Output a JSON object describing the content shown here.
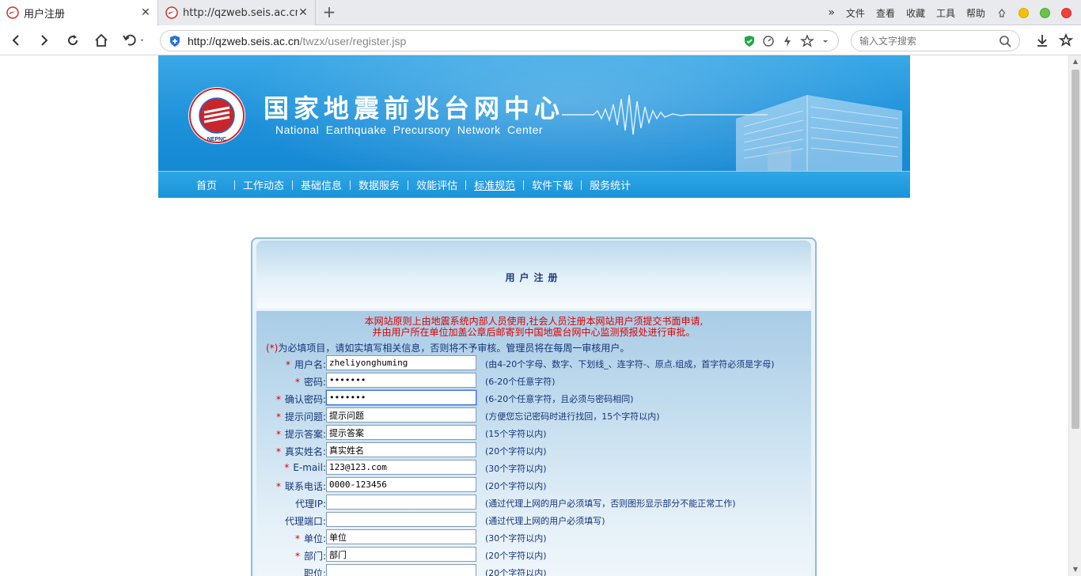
{
  "browser": {
    "tabs": [
      {
        "title": "用户注册",
        "active": true
      },
      {
        "title": "http://qzweb.seis.ac.cn/t",
        "active": false
      }
    ],
    "menu": [
      "文件",
      "查看",
      "收藏",
      "工具",
      "帮助"
    ],
    "url_host": "http://qzweb.seis.ac.cn",
    "url_path": "/twzx/user/register.jsp",
    "search_placeholder": "输入文字搜索"
  },
  "site": {
    "title_cn": "国家地震前兆台网中心",
    "title_en": "National Earthquake Precursory Network Center",
    "logo_text": "NEPNC",
    "nav": [
      "首页",
      "工作动态",
      "基础信息",
      "数据服务",
      "效能评估",
      "标准规范",
      "软件下载",
      "服务统计"
    ]
  },
  "form": {
    "title": "用户注册",
    "notice_line1": "本网站原则上由地震系统内部人员使用,社会人员注册本网站用户须提交书面申请,",
    "notice_line2": "并由用户所在单位加盖公章后邮寄到中国地震台网中心监测预报处进行审批。",
    "required_note_star": "(*)",
    "required_note": "为必填项目，请如实填写相关信息，否则将不予审核。管理员将在每周一审核用户。",
    "fields": [
      {
        "label": "用户名:",
        "required": true,
        "value": "zheliyonghuming",
        "hint": "(由4-20个字母、数字、下划线_、连字符-、原点.组成，首字符必须是字母)"
      },
      {
        "label": "密码:",
        "required": true,
        "value": "•••••••",
        "hint": "(6-20个任意字符)"
      },
      {
        "label": "确认密码:",
        "required": true,
        "value": "•••••••",
        "hint": "(6-20个任意字符，且必须与密码相同)"
      },
      {
        "label": "提示问题:",
        "required": true,
        "value": "提示问题",
        "hint": "(方便您忘记密码时进行找回，15个字符以内)"
      },
      {
        "label": "提示答案:",
        "required": true,
        "value": "提示答案",
        "hint": "(15个字符以内)"
      },
      {
        "label": "真实姓名:",
        "required": true,
        "value": "真实姓名",
        "hint": "(20个字符以内)"
      },
      {
        "label": "E-mail:",
        "required": true,
        "value": "123@123.com",
        "hint": "(30个字符以内)"
      },
      {
        "label": "联系电话:",
        "required": true,
        "value": "0000-123456",
        "hint": "(20个字符以内)"
      },
      {
        "label": "代理IP:",
        "required": false,
        "value": "",
        "hint": "(通过代理上网的用户必须填写，否则图形显示部分不能正常工作)"
      },
      {
        "label": "代理端口:",
        "required": false,
        "value": "",
        "hint": "(通过代理上网的用户必须填写)"
      },
      {
        "label": "单位:",
        "required": true,
        "value": "单位",
        "hint": "(30个字符以内)"
      },
      {
        "label": "部门:",
        "required": true,
        "value": "部门",
        "hint": "(20个字符以内)"
      },
      {
        "label": "职位:",
        "required": false,
        "value": "",
        "hint": "(20个字符以内)"
      }
    ]
  },
  "colors": {
    "banner": "#1d90da",
    "required_star": "#e00000",
    "label_text": "#15357a"
  }
}
